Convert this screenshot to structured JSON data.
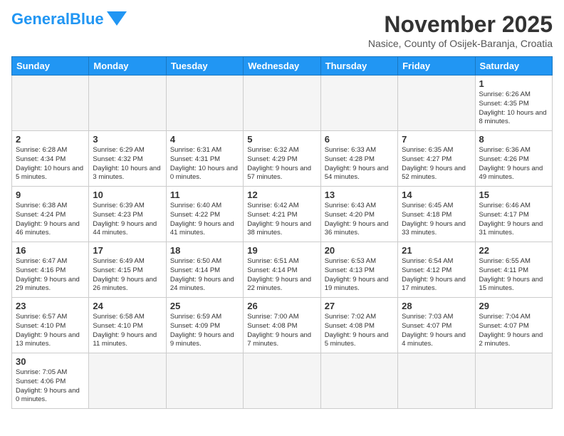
{
  "header": {
    "logo_general": "General",
    "logo_blue": "Blue",
    "month_title": "November 2025",
    "subtitle": "Nasice, County of Osijek-Baranja, Croatia"
  },
  "weekdays": [
    "Sunday",
    "Monday",
    "Tuesday",
    "Wednesday",
    "Thursday",
    "Friday",
    "Saturday"
  ],
  "days": [
    {
      "date": "",
      "info": ""
    },
    {
      "date": "",
      "info": ""
    },
    {
      "date": "",
      "info": ""
    },
    {
      "date": "",
      "info": ""
    },
    {
      "date": "",
      "info": ""
    },
    {
      "date": "",
      "info": ""
    },
    {
      "date": "1",
      "info": "Sunrise: 6:26 AM\nSunset: 4:35 PM\nDaylight: 10 hours\nand 8 minutes."
    },
    {
      "date": "2",
      "info": "Sunrise: 6:28 AM\nSunset: 4:34 PM\nDaylight: 10 hours\nand 5 minutes."
    },
    {
      "date": "3",
      "info": "Sunrise: 6:29 AM\nSunset: 4:32 PM\nDaylight: 10 hours\nand 3 minutes."
    },
    {
      "date": "4",
      "info": "Sunrise: 6:31 AM\nSunset: 4:31 PM\nDaylight: 10 hours\nand 0 minutes."
    },
    {
      "date": "5",
      "info": "Sunrise: 6:32 AM\nSunset: 4:29 PM\nDaylight: 9 hours\nand 57 minutes."
    },
    {
      "date": "6",
      "info": "Sunrise: 6:33 AM\nSunset: 4:28 PM\nDaylight: 9 hours\nand 54 minutes."
    },
    {
      "date": "7",
      "info": "Sunrise: 6:35 AM\nSunset: 4:27 PM\nDaylight: 9 hours\nand 52 minutes."
    },
    {
      "date": "8",
      "info": "Sunrise: 6:36 AM\nSunset: 4:26 PM\nDaylight: 9 hours\nand 49 minutes."
    },
    {
      "date": "9",
      "info": "Sunrise: 6:38 AM\nSunset: 4:24 PM\nDaylight: 9 hours\nand 46 minutes."
    },
    {
      "date": "10",
      "info": "Sunrise: 6:39 AM\nSunset: 4:23 PM\nDaylight: 9 hours\nand 44 minutes."
    },
    {
      "date": "11",
      "info": "Sunrise: 6:40 AM\nSunset: 4:22 PM\nDaylight: 9 hours\nand 41 minutes."
    },
    {
      "date": "12",
      "info": "Sunrise: 6:42 AM\nSunset: 4:21 PM\nDaylight: 9 hours\nand 38 minutes."
    },
    {
      "date": "13",
      "info": "Sunrise: 6:43 AM\nSunset: 4:20 PM\nDaylight: 9 hours\nand 36 minutes."
    },
    {
      "date": "14",
      "info": "Sunrise: 6:45 AM\nSunset: 4:18 PM\nDaylight: 9 hours\nand 33 minutes."
    },
    {
      "date": "15",
      "info": "Sunrise: 6:46 AM\nSunset: 4:17 PM\nDaylight: 9 hours\nand 31 minutes."
    },
    {
      "date": "16",
      "info": "Sunrise: 6:47 AM\nSunset: 4:16 PM\nDaylight: 9 hours\nand 29 minutes."
    },
    {
      "date": "17",
      "info": "Sunrise: 6:49 AM\nSunset: 4:15 PM\nDaylight: 9 hours\nand 26 minutes."
    },
    {
      "date": "18",
      "info": "Sunrise: 6:50 AM\nSunset: 4:14 PM\nDaylight: 9 hours\nand 24 minutes."
    },
    {
      "date": "19",
      "info": "Sunrise: 6:51 AM\nSunset: 4:14 PM\nDaylight: 9 hours\nand 22 minutes."
    },
    {
      "date": "20",
      "info": "Sunrise: 6:53 AM\nSunset: 4:13 PM\nDaylight: 9 hours\nand 19 minutes."
    },
    {
      "date": "21",
      "info": "Sunrise: 6:54 AM\nSunset: 4:12 PM\nDaylight: 9 hours\nand 17 minutes."
    },
    {
      "date": "22",
      "info": "Sunrise: 6:55 AM\nSunset: 4:11 PM\nDaylight: 9 hours\nand 15 minutes."
    },
    {
      "date": "23",
      "info": "Sunrise: 6:57 AM\nSunset: 4:10 PM\nDaylight: 9 hours\nand 13 minutes."
    },
    {
      "date": "24",
      "info": "Sunrise: 6:58 AM\nSunset: 4:10 PM\nDaylight: 9 hours\nand 11 minutes."
    },
    {
      "date": "25",
      "info": "Sunrise: 6:59 AM\nSunset: 4:09 PM\nDaylight: 9 hours\nand 9 minutes."
    },
    {
      "date": "26",
      "info": "Sunrise: 7:00 AM\nSunset: 4:08 PM\nDaylight: 9 hours\nand 7 minutes."
    },
    {
      "date": "27",
      "info": "Sunrise: 7:02 AM\nSunset: 4:08 PM\nDaylight: 9 hours\nand 5 minutes."
    },
    {
      "date": "28",
      "info": "Sunrise: 7:03 AM\nSunset: 4:07 PM\nDaylight: 9 hours\nand 4 minutes."
    },
    {
      "date": "29",
      "info": "Sunrise: 7:04 AM\nSunset: 4:07 PM\nDaylight: 9 hours\nand 2 minutes."
    },
    {
      "date": "30",
      "info": "Sunrise: 7:05 AM\nSunset: 4:06 PM\nDaylight: 9 hours\nand 0 minutes."
    },
    {
      "date": "",
      "info": ""
    },
    {
      "date": "",
      "info": ""
    },
    {
      "date": "",
      "info": ""
    },
    {
      "date": "",
      "info": ""
    },
    {
      "date": "",
      "info": ""
    },
    {
      "date": "",
      "info": ""
    }
  ]
}
